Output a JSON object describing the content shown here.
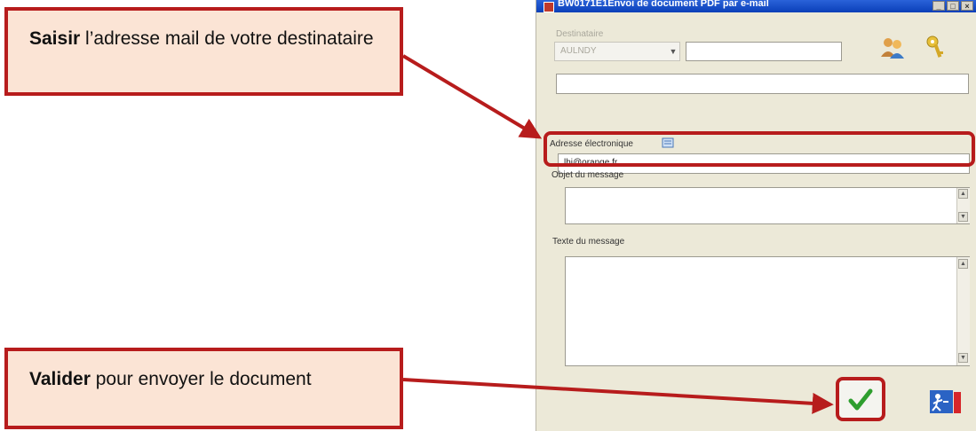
{
  "dialog": {
    "title": "BW0171E1Envoi de document PDF par e-mail",
    "window_buttons": [
      "_",
      "□",
      "×"
    ],
    "destinataire": {
      "label": "Destinataire",
      "select_value": "AULNDY",
      "name_value": ""
    },
    "address_line_value": "",
    "email": {
      "label": "Adresse électronique",
      "value": "lhi@orange.fr",
      "icon": "address-book-icon"
    },
    "subject": {
      "label": "Objet du message",
      "value": ""
    },
    "body": {
      "label": "Texte du message",
      "value": ""
    },
    "icons": {
      "users": "users-icon",
      "keys": "keys-icon",
      "validate": "checkmark-icon",
      "exit": "exit-door-icon"
    }
  },
  "callouts": {
    "enter_email": {
      "bold": "Saisir",
      "text": " l’adresse mail de votre destinataire"
    },
    "validate": {
      "bold": "Valider",
      "text": " pour envoyer le document"
    }
  },
  "colors": {
    "annotation_red": "#b71c1c",
    "callout_fill": "#fbe4d5",
    "window_bg": "#ece9d8",
    "checkmark_green": "#2e9e2e"
  }
}
